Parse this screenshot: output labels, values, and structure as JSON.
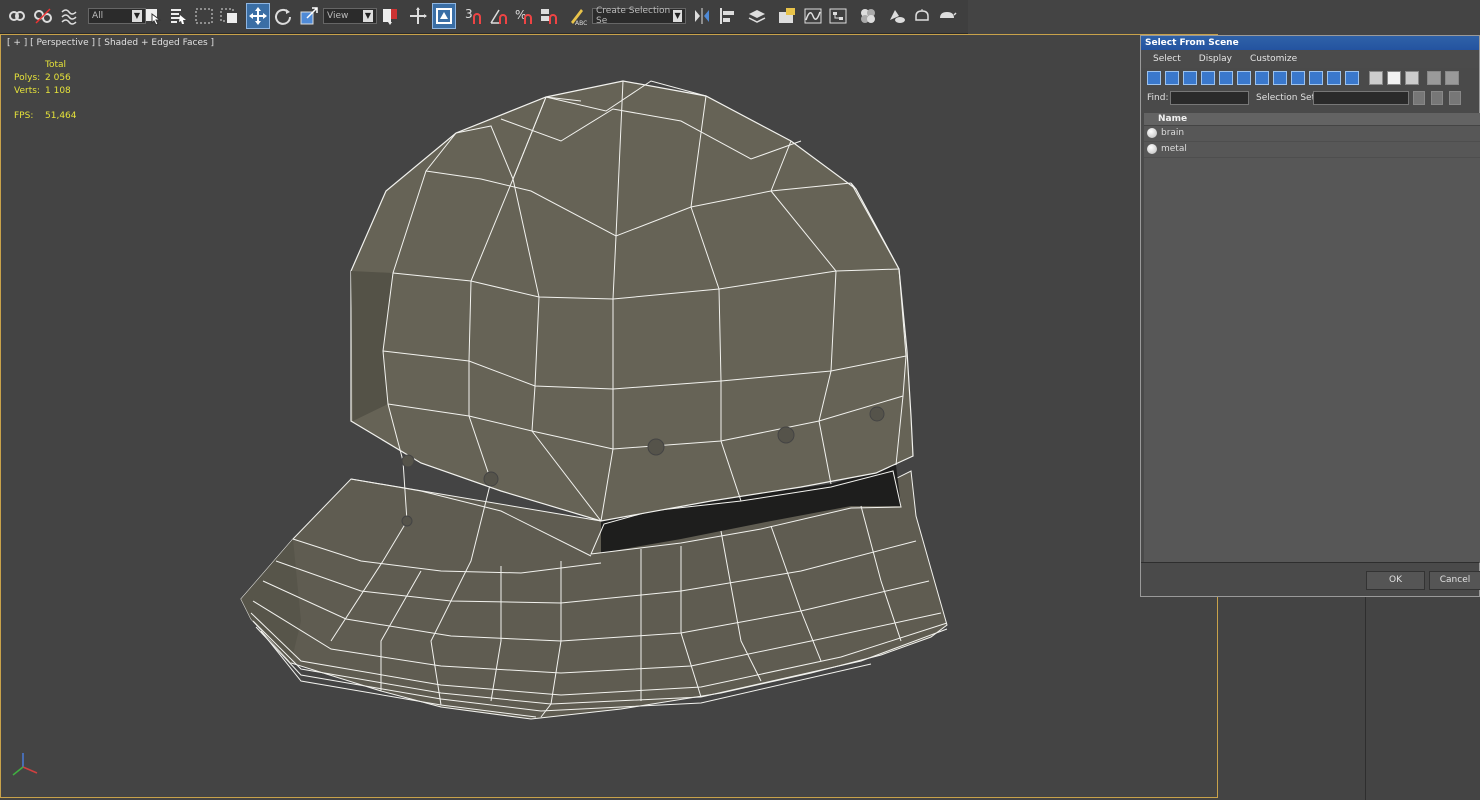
{
  "toolbar": {
    "selection_filter": "All",
    "reference_coord": "View",
    "named_selection_set": "Create Selection Se",
    "snap_3d_label": "3",
    "percent_snap_label": "%"
  },
  "viewport": {
    "label": "[ + ] [ Perspective ] [ Shaded + Edged Faces ]",
    "stats": {
      "total_label": "Total",
      "polys_label": "Polys:",
      "polys_value": "2 056",
      "verts_label": "Verts:",
      "verts_value": "1 108",
      "fps_label": "FPS:",
      "fps_value": "51,464"
    }
  },
  "dialog": {
    "title": "Select From Scene",
    "menu": [
      "Select",
      "Display",
      "Customize"
    ],
    "find_label": "Find:",
    "find_value": "",
    "selection_set_label": "Selection Set:",
    "selection_set_value": "",
    "column_name": "Name",
    "items": [
      "brain",
      "metal"
    ],
    "ok_label": "OK",
    "cancel_label": "Cancel"
  },
  "colors": {
    "accent": "#3a78cc",
    "viewport_border": "#c8a24a",
    "stats_text": "#e5e23a",
    "mesh_fill": "#615e51",
    "wire": "#f5f5f0"
  }
}
